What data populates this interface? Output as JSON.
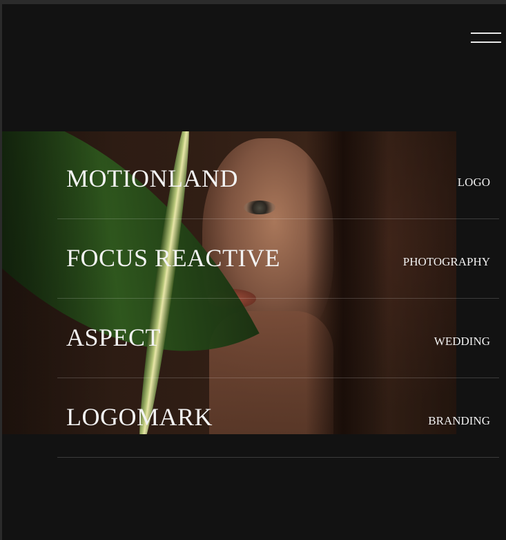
{
  "header": {
    "menu_icon": "hamburger-menu-icon"
  },
  "hero": {
    "image": "portrait-with-green-leaf"
  },
  "projects": [
    {
      "title": "MOTIONLAND",
      "category": "LOGO"
    },
    {
      "title": "FOCUS REACTIVE",
      "category": "PHOTOGRAPHY"
    },
    {
      "title": "ASPECT",
      "category": "WEDDING"
    },
    {
      "title": "LOGOMARK",
      "category": "BRANDING"
    }
  ],
  "colors": {
    "background": "#121212",
    "text": "#f3f3f3",
    "divider": "#3a3a3a"
  }
}
